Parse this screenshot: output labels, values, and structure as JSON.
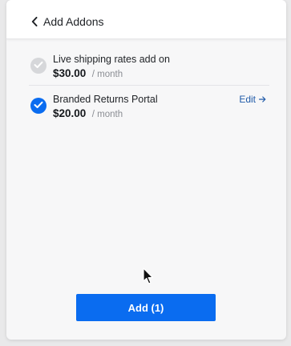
{
  "header": {
    "back_label": "Add Addons",
    "back_icon": "chevron-left-icon"
  },
  "addons": [
    {
      "name": "Live shipping rates add on",
      "price": "$30.00",
      "period": "/ month",
      "checked": true,
      "disabled": true
    },
    {
      "name": "Branded Returns Portal",
      "price": "$20.00",
      "period": "/ month",
      "checked": true,
      "disabled": false,
      "edit_label": "Edit"
    }
  ],
  "footer": {
    "add_button_label": "Add (1)"
  },
  "colors": {
    "accent": "#0a6cf0",
    "disabled_check": "#d6d7da",
    "link": "#1f5aa8"
  }
}
